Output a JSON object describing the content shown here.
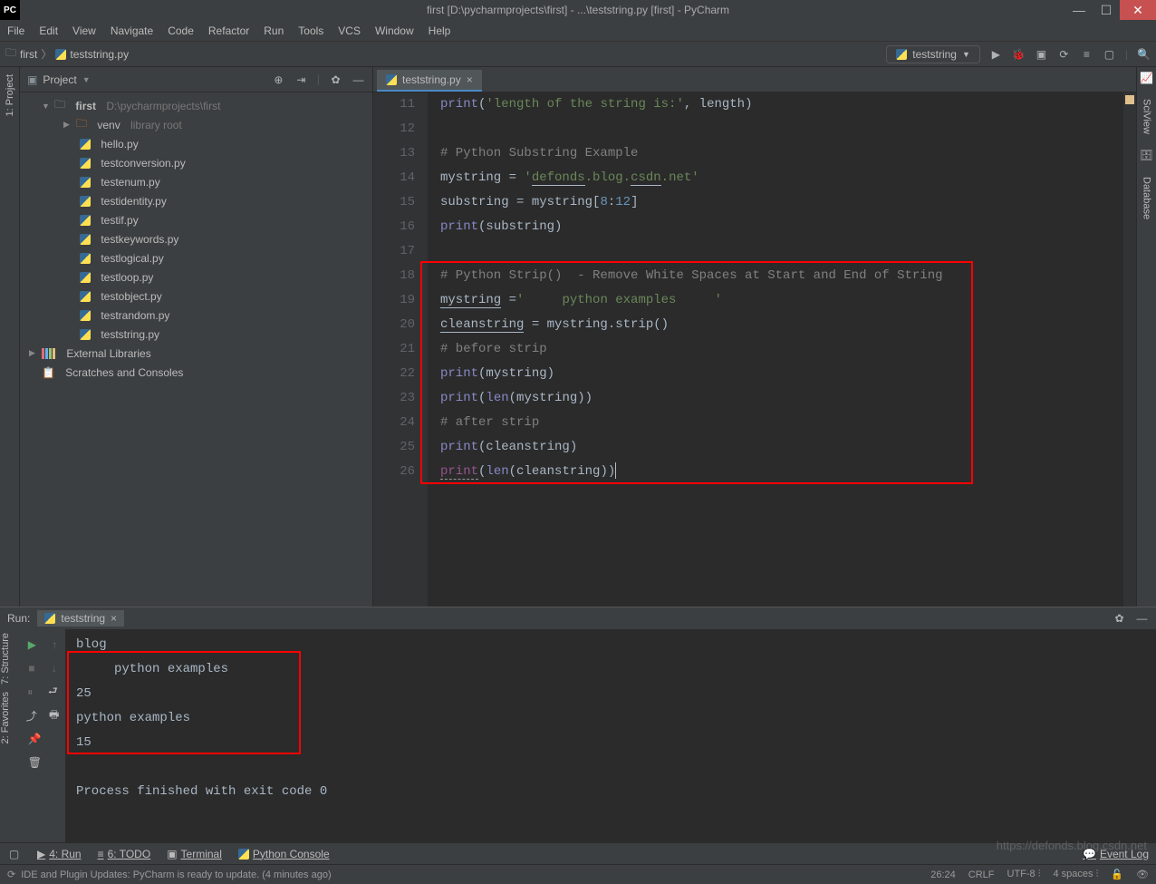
{
  "window": {
    "title": "first [D:\\pycharmprojects\\first] - ...\\teststring.py [first] - PyCharm",
    "pc": "PC"
  },
  "menu": [
    "File",
    "Edit",
    "View",
    "Navigate",
    "Code",
    "Refactor",
    "Run",
    "Tools",
    "VCS",
    "Window",
    "Help"
  ],
  "breadcrumb": {
    "project": "first",
    "file": "teststring.py"
  },
  "runconfig": {
    "label": "teststring"
  },
  "project_panel": {
    "title": "Project"
  },
  "tree": {
    "root": {
      "name": "first",
      "path": "D:\\pycharmprojects\\first"
    },
    "venv": {
      "name": "venv",
      "note": "library root"
    },
    "files": [
      "hello.py",
      "testconversion.py",
      "testenum.py",
      "testidentity.py",
      "testif.py",
      "testkeywords.py",
      "testlogical.py",
      "testloop.py",
      "testobject.py",
      "testrandom.py",
      "teststring.py"
    ],
    "ext": "External Libraries",
    "scratch": "Scratches and Consoles"
  },
  "tabs": {
    "active": "teststring.py"
  },
  "gutter": [
    "11",
    "12",
    "13",
    "14",
    "15",
    "16",
    "17",
    "18",
    "19",
    "20",
    "21",
    "22",
    "23",
    "24",
    "25",
    "26"
  ],
  "run": {
    "label": "Run:",
    "tab": "teststring",
    "output": [
      "blog",
      "     python examples",
      "25",
      "python examples",
      "15",
      "",
      "Process finished with exit code 0"
    ]
  },
  "left_tools": [
    "1: Project"
  ],
  "right_tools": [
    "SciView",
    "Database"
  ],
  "left_bottom": [
    "7: Structure",
    "2: Favorites"
  ],
  "bottom": {
    "run": "4: Run",
    "todo": "6: TODO",
    "terminal": "Terminal",
    "pyconsole": "Python Console",
    "eventlog": "Event Log"
  },
  "status": {
    "msg": "IDE and Plugin Updates: PyCharm is ready to update. (4 minutes ago)",
    "pos": "26:24",
    "crlf": "CRLF",
    "enc": "UTF-8",
    "indent": "4 spaces"
  },
  "watermark": "https://defonds.blog.csdn.net"
}
